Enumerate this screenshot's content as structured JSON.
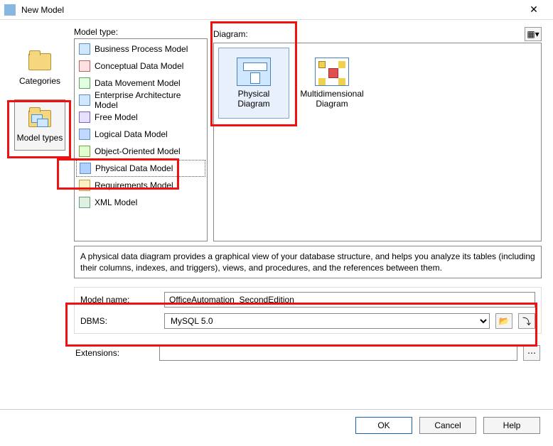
{
  "window": {
    "title": "New Model",
    "close": "✕"
  },
  "left": {
    "categories_label": "Categories",
    "modeltypes_label": "Model types"
  },
  "labels": {
    "model_type": "Model type:",
    "diagram": "Diagram:"
  },
  "model_types": {
    "items": [
      {
        "label": "Business Process Model",
        "icon": "bp"
      },
      {
        "label": "Conceptual Data Model",
        "icon": "cd"
      },
      {
        "label": "Data Movement Model",
        "icon": "dm"
      },
      {
        "label": "Enterprise Architecture Model",
        "icon": "ea"
      },
      {
        "label": "Free Model",
        "icon": "fm"
      },
      {
        "label": "Logical Data Model",
        "icon": "ld"
      },
      {
        "label": "Object-Oriented Model",
        "icon": "oo"
      },
      {
        "label": "Physical Data Model",
        "icon": "pd"
      },
      {
        "label": "Requirements Model",
        "icon": "rq"
      },
      {
        "label": "XML Model",
        "icon": "xm"
      }
    ],
    "selected_index": 7
  },
  "diagrams": {
    "items": [
      {
        "label": "Physical Diagram",
        "icon": "phys"
      },
      {
        "label": "Multidimensional Diagram",
        "icon": "multi"
      }
    ],
    "selected_index": 0
  },
  "view_dropdown_glyph": "▾",
  "view_icon_glyph": "▦",
  "description": "A physical data diagram provides a graphical view of your database structure, and helps you analyze its tables (including their columns, indexes, and triggers), views, and procedures, and the references between them.",
  "form": {
    "model_name_label": "Model name:",
    "model_name_value": "OfficeAutomation_SecondEdition",
    "dbms_label": "DBMS:",
    "dbms_value": "MySQL 5.0",
    "extensions_label": "Extensions:",
    "extensions_value": ""
  },
  "icons": {
    "folder_open": "📂",
    "arrow_in": "⤵",
    "list_ext": "⋯"
  },
  "footer": {
    "ok": "OK",
    "cancel": "Cancel",
    "help": "Help"
  },
  "colors": {
    "highlight": "#e11"
  }
}
